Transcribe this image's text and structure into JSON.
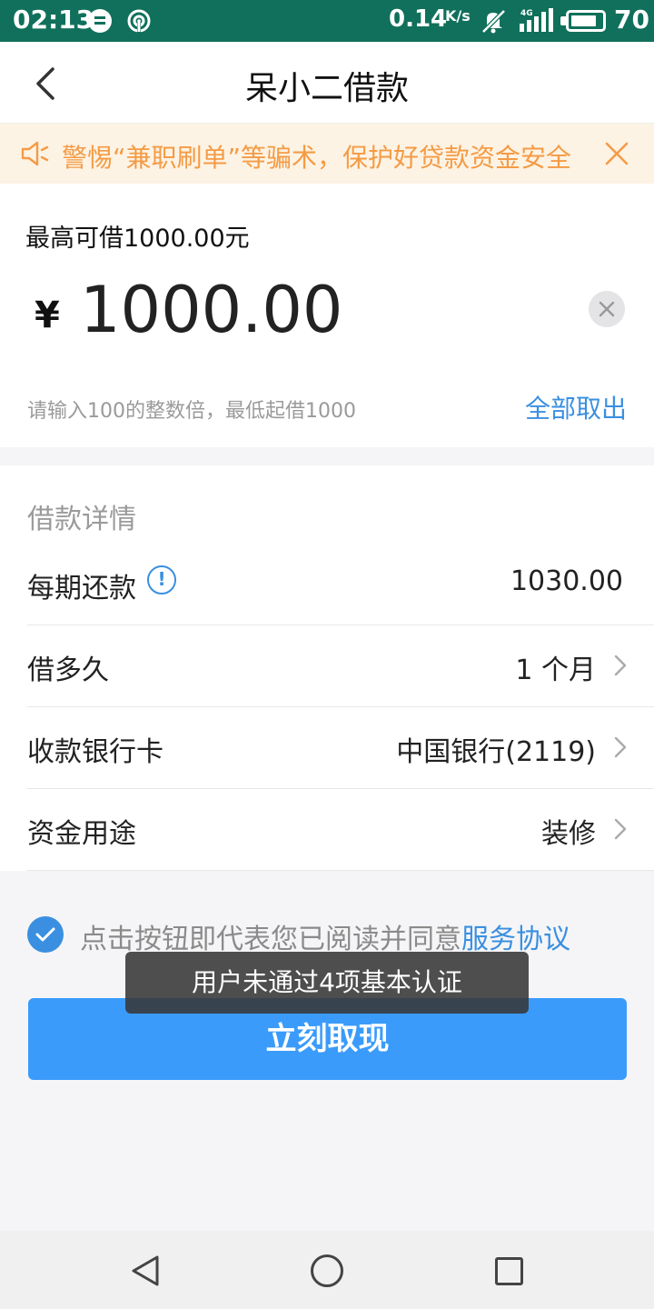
{
  "status_bar": {
    "time": "02:13",
    "net_speed": "0.14",
    "net_speed_unit": "K/s",
    "network_type": "4G",
    "battery": "70"
  },
  "header": {
    "title": "呆小二借款"
  },
  "notice": {
    "text": "警惕“兼职刷单”等骗术，保护好贷款资金安全"
  },
  "amount": {
    "max_label": "最高可借1000.00元",
    "currency_symbol": "¥",
    "value": "1000.00",
    "hint": "请输入100的整数倍，最低起借1000",
    "withdraw_all_label": "全部取出"
  },
  "details": {
    "title": "借款详情",
    "rows": [
      {
        "label": "每期还款",
        "value": "1030.00"
      },
      {
        "label": "借多久",
        "value": "1 个月"
      },
      {
        "label": "收款银行卡",
        "value": "中国银行(2119)"
      },
      {
        "label": "资金用途",
        "value": "装修"
      }
    ]
  },
  "agreement": {
    "text": "点击按钮即代表您已阅读并同意",
    "link": "服务协议",
    "checked": true
  },
  "cta": {
    "label": "立刻取现"
  },
  "toast": {
    "text": "用户未通过4项基本认证"
  },
  "colors": {
    "status_bar": "#10705b",
    "accent": "#3a8fe0",
    "cta": "#3a9bfb",
    "notice_bg": "#fdf3e4",
    "notice_text": "#f49b45"
  }
}
